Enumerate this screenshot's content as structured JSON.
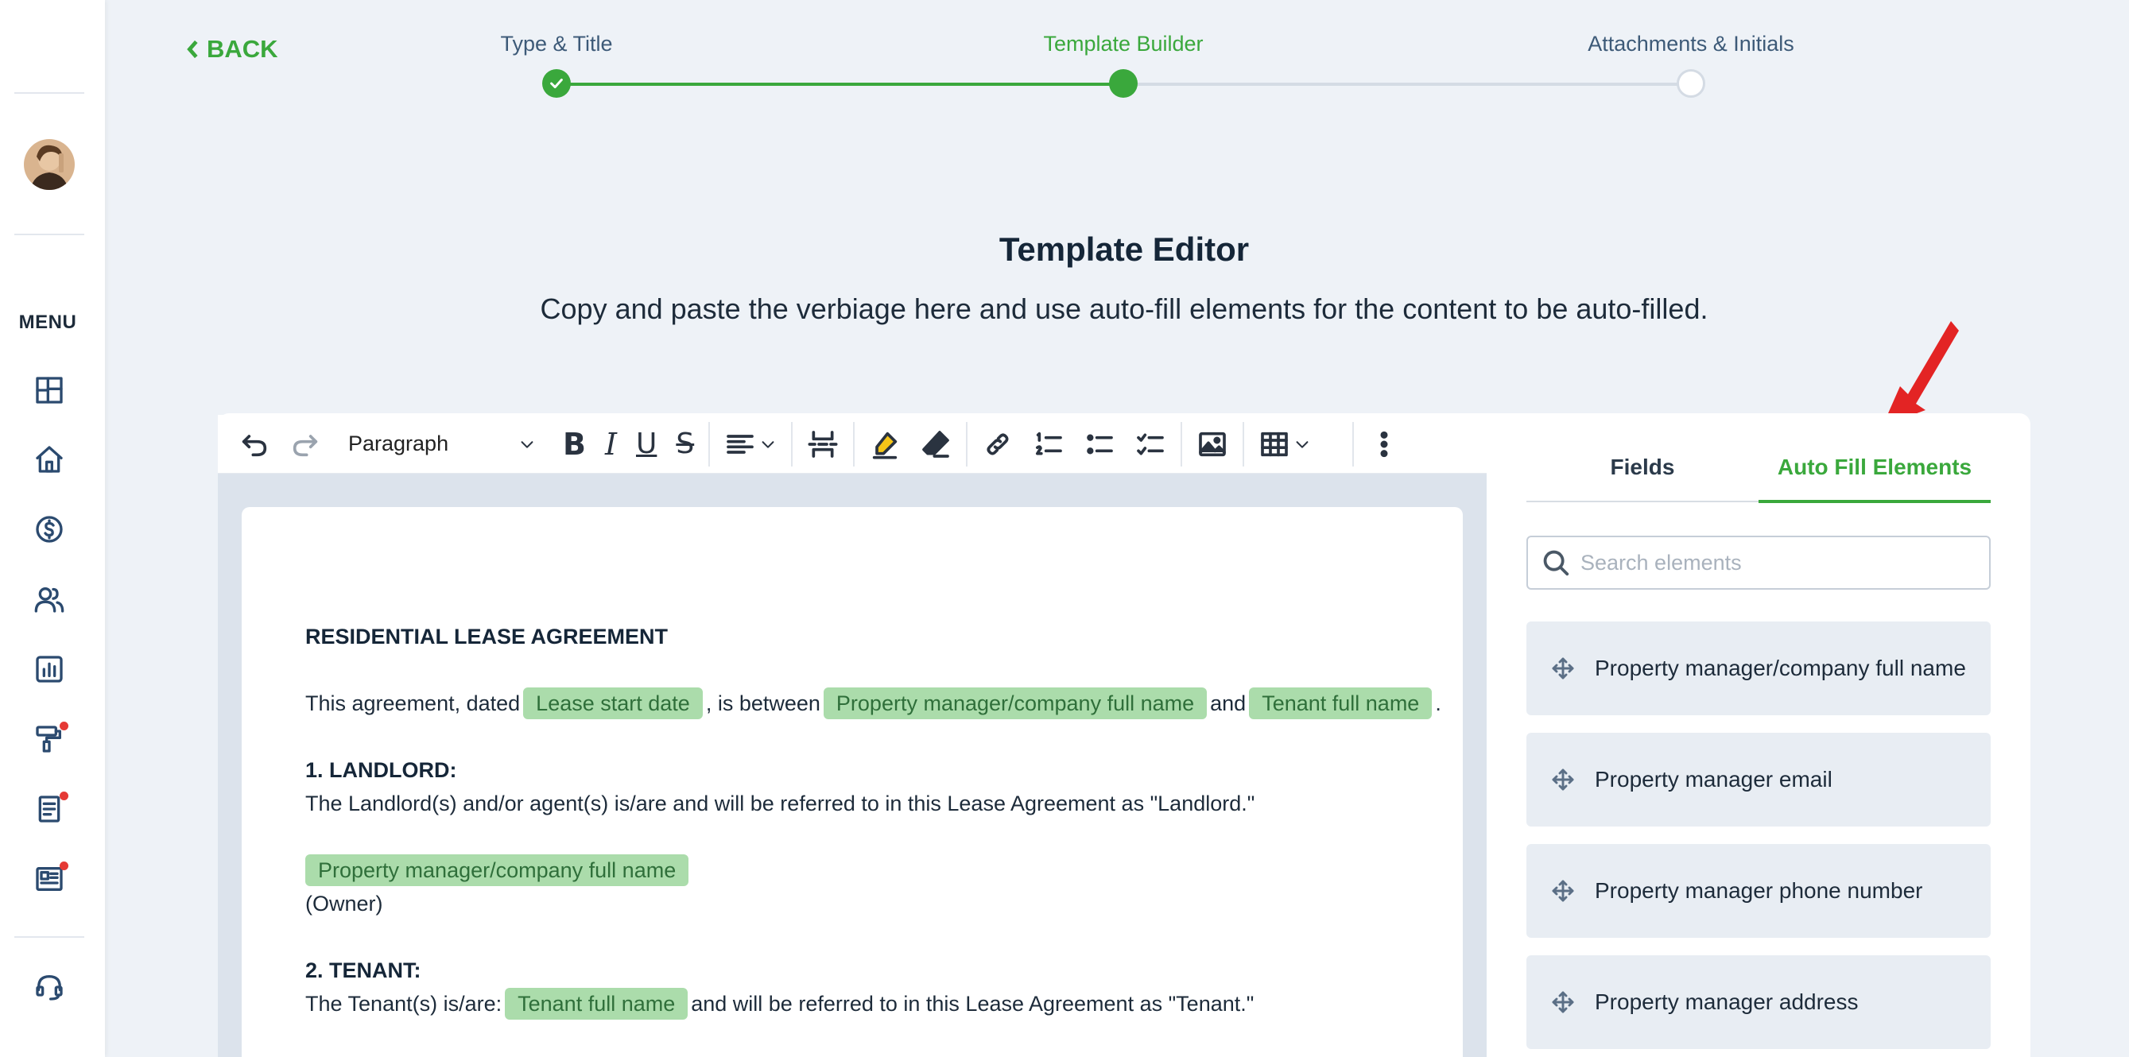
{
  "sidebar": {
    "menu_label": "MENU",
    "icons": [
      "dashboard-icon",
      "home-icon",
      "dollar-icon",
      "users-icon",
      "reports-icon",
      "maintenance-icon",
      "document-icon",
      "news-icon",
      "support-icon"
    ],
    "notification_color": "#e53935"
  },
  "nav": {
    "back_label": "BACK"
  },
  "stepper": {
    "steps": [
      {
        "label": "Type & Title",
        "state": "complete"
      },
      {
        "label": "Template Builder",
        "state": "active"
      },
      {
        "label": "Attachments & Initials",
        "state": "pending"
      }
    ],
    "accent_color": "#3aa83c"
  },
  "header": {
    "title": "Template Editor",
    "subtitle": "Copy and paste the verbiage here and use auto-fill elements for the content to be auto-filled."
  },
  "toolbar": {
    "block_style": "Paragraph"
  },
  "document": {
    "title": "RESIDENTIAL LEASE AGREEMENT",
    "p1": {
      "t1": "This agreement, dated",
      "chip1": "Lease start date",
      "t2": ", is between",
      "chip2": "Property manager/company full name",
      "t3": "and",
      "chip3": "Tenant full name",
      "t4": "."
    },
    "s1": {
      "heading": "1. LANDLORD:",
      "text": "The Landlord(s) and/or agent(s) is/are and will be referred to in this Lease Agreement as \"Landlord.\"",
      "chip": "Property manager/company full name",
      "owner": "(Owner)"
    },
    "s2": {
      "heading": "2. TENANT:",
      "t1": "The Tenant(s) is/are:",
      "chip": "Tenant full name",
      "t2": "and will be referred to in this Lease Agreement as \"Tenant.\""
    }
  },
  "panel": {
    "tabs": [
      "Fields",
      "Auto Fill Elements"
    ],
    "active_tab": "Auto Fill Elements",
    "search_placeholder": "Search elements",
    "elements": [
      "Property manager/company full name",
      "Property manager email",
      "Property manager phone number",
      "Property manager address"
    ]
  }
}
